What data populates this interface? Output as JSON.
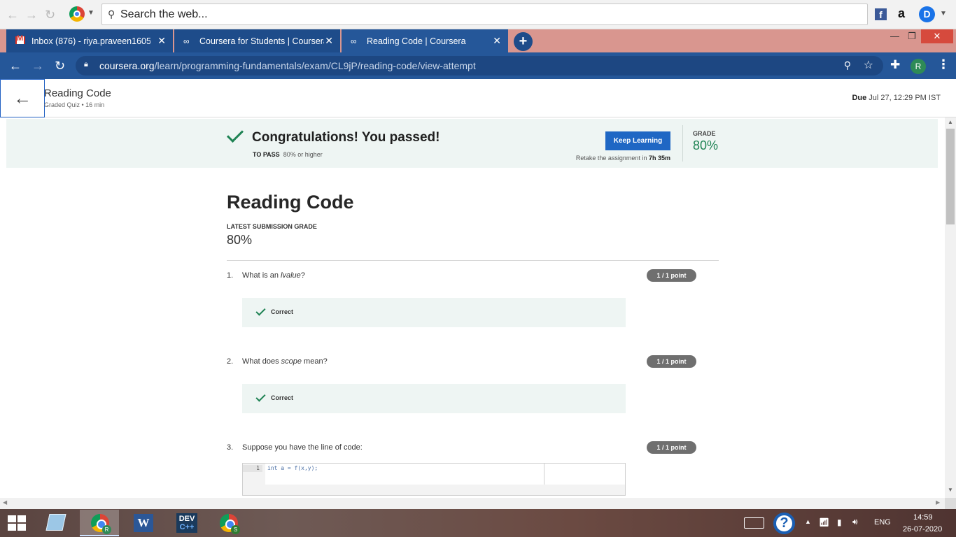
{
  "top_toolbar": {
    "search_placeholder": "Search the web..."
  },
  "tabs": [
    {
      "title": "Inbox (876) - riya.praveen1605@",
      "icon": "gmail-icon"
    },
    {
      "title": "Coursera for Students | Coursera",
      "icon": "coursera-icon"
    },
    {
      "title": "Reading Code | Coursera",
      "icon": "coursera-icon",
      "active": true
    }
  ],
  "address_bar": {
    "url_host": "coursera.org",
    "url_path": "/learn/programming-fundamentals/exam/CL9jP/reading-code/view-attempt",
    "profile_initial": "R"
  },
  "header": {
    "title": "Reading Code",
    "subtitle": "Graded Quiz • 16 min",
    "due_label": "Due",
    "due_date": "Jul 27, 12:29 PM IST"
  },
  "banner": {
    "heading": "Congratulations! You passed!",
    "to_pass_label": "TO PASS",
    "to_pass_value": "80% or higher",
    "keep_learning": "Keep Learning",
    "retake_text": "Retake the assignment in",
    "retake_time": "7h 35m",
    "grade_label": "GRADE",
    "grade_value": "80%"
  },
  "quiz": {
    "title": "Reading Code",
    "latest_label": "LATEST SUBMISSION GRADE",
    "latest_value": "80%",
    "questions": [
      {
        "num": "1.",
        "pre": "What is an ",
        "em": "lvalue",
        "post": "?",
        "points": "1 / 1 point",
        "feedback": "Correct"
      },
      {
        "num": "2.",
        "pre": "What does ",
        "em": "scope",
        "post": " mean?",
        "points": "1 / 1 point",
        "feedback": "Correct"
      },
      {
        "num": "3.",
        "pre": "Suppose you have the line of code:",
        "em": "",
        "post": "",
        "points": "1 / 1 point"
      }
    ],
    "code": {
      "line_no": "1",
      "text": "int a = f(x,y);"
    }
  },
  "taskbar": {
    "chrome_badge_1": "R",
    "word_label": "W",
    "dev_label_top": "DEV",
    "dev_label_bottom": "C++",
    "chrome_badge_2": "S",
    "lang": "ENG",
    "time": "14:59",
    "date": "26-07-2020"
  },
  "colors": {
    "accent_blue": "#1f67c4",
    "success_green": "#1f8354",
    "tab_bar_blue": "#255799"
  }
}
